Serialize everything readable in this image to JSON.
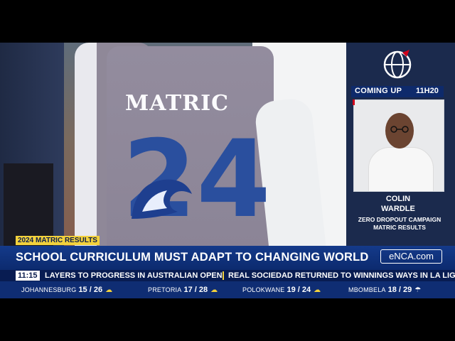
{
  "coming_up": {
    "label": "COMING UP",
    "time": "11H20"
  },
  "guest": {
    "name_line1": "COLIN",
    "name_line2": "WARDLE",
    "role_line1": "ZERO DROPOUT CAMPAIGN",
    "role_line2": "MATRIC RESULTS"
  },
  "scene": {
    "jacket_text": "MATRIC",
    "jacket_number": "24"
  },
  "topic_tag": "2024 MATRIC RESULTS",
  "headline": "SCHOOL CURRICULUM MUST ADAPT TO CHANGING WORLD",
  "brand": "eNCA.com",
  "ticker": {
    "time": "11:15",
    "items": [
      "LAYERS TO PROGRESS IN AUSTRALIAN OPEN",
      "REAL SOCIEDAD RETURNED TO WINNINGS WAYS IN LA LIGA"
    ]
  },
  "weather": [
    {
      "city": "JOHANNESBURG",
      "temps": "15 / 26",
      "icon": "partly-cloudy-icon"
    },
    {
      "city": "PRETORIA",
      "temps": "17 / 28",
      "icon": "partly-cloudy-icon"
    },
    {
      "city": "POLOKWANE",
      "temps": "19 / 24",
      "icon": "partly-cloudy-icon"
    },
    {
      "city": "MBOMBELA",
      "temps": "18 / 29",
      "icon": "rain-cloud-icon"
    }
  ],
  "colors": {
    "accent_yellow": "#f2d13c",
    "navy": "#0c2a6e",
    "brand_red": "#d0021b"
  }
}
